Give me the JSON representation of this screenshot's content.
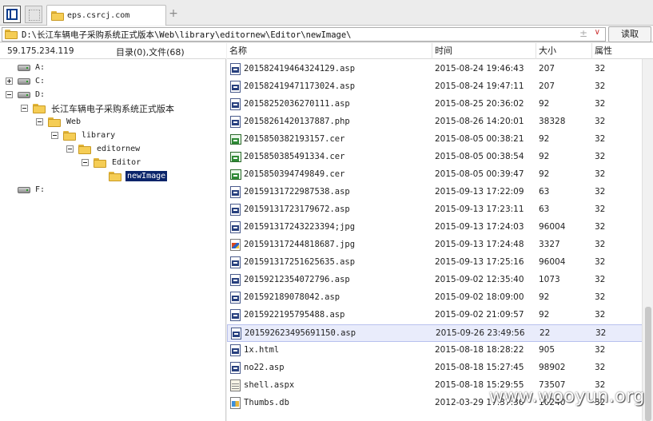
{
  "tab": {
    "title": "eps.csrcj.com",
    "add": "+"
  },
  "address": {
    "path": "D:\\长江车辆电子采购系统正式版本\\Web\\library\\editornew\\Editor\\newImage\\",
    "plus": "±",
    "dropdown": "∨",
    "read_button": "读取"
  },
  "left": {
    "ip": "59.175.234.119",
    "summary": "目录(0),文件(68)",
    "tree": [
      {
        "label": "A:",
        "type": "drive",
        "expander": "none"
      },
      {
        "label": "C:",
        "type": "drive",
        "expander": "plus"
      },
      {
        "label": "D:",
        "type": "drive",
        "expander": "minus"
      },
      {
        "label": "长江车辆电子采购系统正式版本",
        "type": "folder",
        "expander": "minus"
      },
      {
        "label": "Web",
        "type": "folder",
        "expander": "minus"
      },
      {
        "label": "library",
        "type": "folder",
        "expander": "minus"
      },
      {
        "label": "editornew",
        "type": "folder",
        "expander": "minus"
      },
      {
        "label": "Editor",
        "type": "folder",
        "expander": "minus"
      },
      {
        "label": "newImage",
        "type": "folder",
        "expander": "none",
        "selected": true
      },
      {
        "label": "F:",
        "type": "drive",
        "expander": "none"
      }
    ]
  },
  "columns": {
    "name": "名称",
    "time": "时间",
    "size": "大小",
    "attr": "属性"
  },
  "files": [
    {
      "name": "201582419464324129.asp",
      "time": "2015-08-24 19:46:43",
      "size": "207",
      "attr": "32",
      "icon": "asp-file-icon"
    },
    {
      "name": "201582419471173024.asp",
      "time": "2015-08-24 19:47:11",
      "size": "207",
      "attr": "32",
      "icon": "asp-file-icon"
    },
    {
      "name": "20158252036270111.asp",
      "time": "2015-08-25 20:36:02",
      "size": "92",
      "attr": "32",
      "icon": "asp-file-icon"
    },
    {
      "name": "20158261420137887.php",
      "time": "2015-08-26 14:20:01",
      "size": "38328",
      "attr": "32",
      "icon": "php-file-icon"
    },
    {
      "name": "2015850382193157.cer",
      "time": "2015-08-05 00:38:21",
      "size": "92",
      "attr": "32",
      "icon": "cer-file-icon"
    },
    {
      "name": "2015850385491334.cer",
      "time": "2015-08-05 00:38:54",
      "size": "92",
      "attr": "32",
      "icon": "cer-file-icon"
    },
    {
      "name": "2015850394749849.cer",
      "time": "2015-08-05 00:39:47",
      "size": "92",
      "attr": "32",
      "icon": "cer-file-icon"
    },
    {
      "name": "20159131722987538.asp",
      "time": "2015-09-13 17:22:09",
      "size": "63",
      "attr": "32",
      "icon": "asp-file-icon"
    },
    {
      "name": "20159131723179672.asp",
      "time": "2015-09-13 17:23:11",
      "size": "63",
      "attr": "32",
      "icon": "asp-file-icon"
    },
    {
      "name": "201591317243223394;jpg",
      "time": "2015-09-13 17:24:03",
      "size": "96004",
      "attr": "32",
      "icon": "asp-file-icon"
    },
    {
      "name": "201591317244818687.jpg",
      "time": "2015-09-13 17:24:48",
      "size": "3327",
      "attr": "32",
      "icon": "jpg-file-icon"
    },
    {
      "name": "201591317251625635.asp",
      "time": "2015-09-13 17:25:16",
      "size": "96004",
      "attr": "32",
      "icon": "asp-file-icon"
    },
    {
      "name": "20159212354072796.asp",
      "time": "2015-09-02 12:35:40",
      "size": "1073",
      "attr": "32",
      "icon": "asp-file-icon"
    },
    {
      "name": "20159218907804­2.asp",
      "time": "2015-09-02 18:09:00",
      "size": "92",
      "attr": "32",
      "icon": "asp-file-icon"
    },
    {
      "name": "20159221957954­88.asp",
      "time": "2015-09-02 21:09:57",
      "size": "92",
      "attr": "32",
      "icon": "asp-file-icon"
    },
    {
      "name": "201592623495691150.asp",
      "time": "2015-09-26 23:49:56",
      "size": "22",
      "attr": "32",
      "icon": "asp-file-icon",
      "selected": true
    },
    {
      "name": "1x.html",
      "time": "2015-08-18 18:28:22",
      "size": "905",
      "attr": "32",
      "icon": "html-file-icon"
    },
    {
      "name": "no22.asp",
      "time": "2015-08-18 15:27:45",
      "size": "98902",
      "attr": "32",
      "icon": "asp-file-icon"
    },
    {
      "name": "shell.aspx",
      "time": "2015-08-18 15:29:55",
      "size": "73507",
      "attr": "32",
      "icon": "aspx-file-icon"
    },
    {
      "name": "Thumbs.db",
      "time": "2012-03-29 17:37:36",
      "size": "10240",
      "attr": "32",
      "icon": "db-file-icon"
    }
  ],
  "watermark": "www.wooyun.org"
}
